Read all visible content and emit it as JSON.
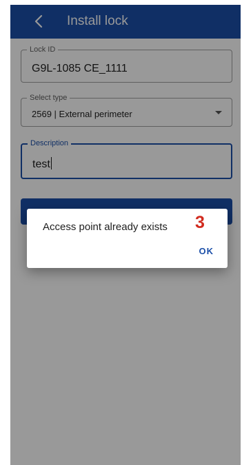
{
  "appbar": {
    "title": "Install lock",
    "back_icon": "chevron-left-icon",
    "color": "#1b4fa8"
  },
  "form": {
    "lock_id": {
      "label": "Lock ID",
      "value": "G9L-1085 CE_1111"
    },
    "type": {
      "label": "Select type",
      "value": "2569 | External perimeter",
      "icon": "dropdown-arrow-icon"
    },
    "description": {
      "label": "Description",
      "value": "test"
    }
  },
  "dialog": {
    "message": "Access point already exists",
    "step_marker": "3",
    "ok_label": "OK",
    "step_color": "#d12b1f"
  }
}
